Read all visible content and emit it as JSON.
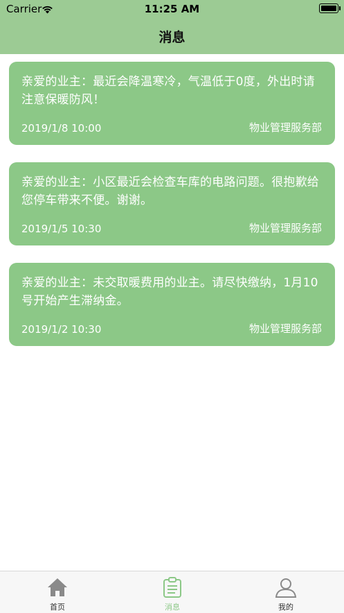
{
  "status_bar": {
    "carrier": "Carrier",
    "time": "11:25 AM"
  },
  "header": {
    "title": "消息"
  },
  "messages": [
    {
      "text": "亲爱的业主：最近会降温寒冷，气温低于0度，外出时请注意保暖防风！",
      "date": "2019/1/8 10:00",
      "sender": "物业管理服务部"
    },
    {
      "text": "亲爱的业主：小区最近会检查车库的电路问题。很抱歉给您停车带来不便。谢谢。",
      "date": "2019/1/5 10:30",
      "sender": "物业管理服务部"
    },
    {
      "text": "亲爱的业主：未交取暖费用的业主。请尽快缴纳，1月10号开始产生滞纳金。",
      "date": "2019/1/2 10:30",
      "sender": "物业管理服务部"
    }
  ],
  "tabbar": {
    "items": [
      {
        "label": "首页",
        "icon": "home-icon"
      },
      {
        "label": "消息",
        "icon": "message-icon",
        "active": true
      },
      {
        "label": "我的",
        "icon": "profile-icon"
      }
    ]
  },
  "colors": {
    "accent": "#8cc887",
    "header": "#9ccb94"
  }
}
